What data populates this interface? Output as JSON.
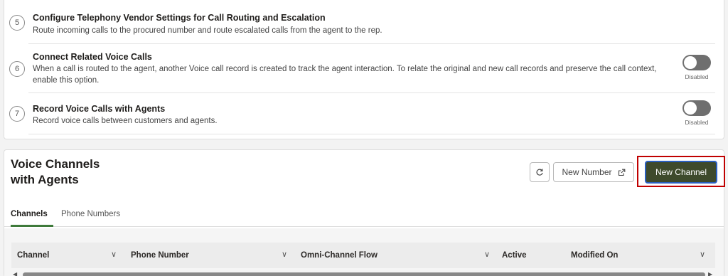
{
  "steps": [
    {
      "number": "5",
      "title": "Configure Telephony Vendor Settings for Call Routing and Escalation",
      "description": "Route incoming calls to the procured number and route escalated calls from the agent to the rep."
    },
    {
      "number": "6",
      "title": "Connect Related Voice Calls",
      "description": "When a call is routed to the agent, another Voice call record is created to track the agent interaction. To relate the original and new call records and preserve the call context, enable this option.",
      "toggle_label": "Disabled",
      "toggle_on": false
    },
    {
      "number": "7",
      "title": "Record Voice Calls with Agents",
      "description": "Record voice calls between customers and agents.",
      "toggle_label": "Disabled",
      "toggle_on": false
    }
  ],
  "channels_section": {
    "title": "Voice Channels with Agents",
    "new_number_label": "New Number",
    "new_channel_label": "New Channel",
    "tabs": [
      {
        "label": "Channels",
        "active": true
      },
      {
        "label": "Phone Numbers",
        "active": false
      }
    ],
    "columns": [
      "Channel",
      "Phone Number",
      "Omni-Channel Flow",
      "Active",
      "Modified On"
    ]
  },
  "colors": {
    "primary_button": "#3e4a2c",
    "highlight": "#c00000",
    "active_tab": "#3e7a3a"
  },
  "icons": [
    "refresh-icon",
    "external-link-icon",
    "chevron-down-icon"
  ]
}
